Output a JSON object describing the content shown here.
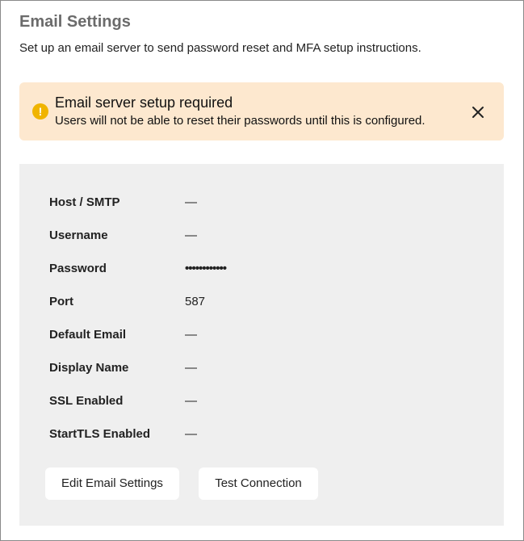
{
  "page": {
    "title": "Email Settings",
    "subtitle": "Set up an email server to send password reset and MFA setup instructions."
  },
  "alert": {
    "icon": "warning-circle-icon",
    "icon_glyph": "!",
    "title": "Email server setup required",
    "description": "Users will not be able to reset their passwords until this is configured.",
    "close_icon": "close-icon",
    "color": "#fde8cf",
    "icon_color": "#f0b400"
  },
  "settings": {
    "rows": [
      {
        "label": "Host / SMTP",
        "value": "—"
      },
      {
        "label": "Username",
        "value": "—"
      },
      {
        "label": "Password",
        "value": "••••••••••••"
      },
      {
        "label": "Port",
        "value": "587"
      },
      {
        "label": "Default Email",
        "value": "—"
      },
      {
        "label": "Display Name",
        "value": "—"
      },
      {
        "label": "SSL Enabled",
        "value": "—"
      },
      {
        "label": "StartTLS Enabled",
        "value": "—"
      }
    ]
  },
  "actions": {
    "edit_label": "Edit Email Settings",
    "test_label": "Test Connection"
  }
}
